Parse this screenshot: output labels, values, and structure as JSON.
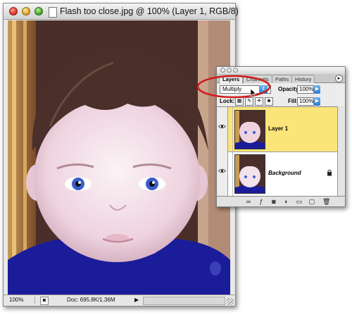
{
  "document": {
    "title": "Flash too close.jpg @ 100% (Layer 1, RGB/8)",
    "zoom": "100%",
    "doc_info": "Doc: 695.8K/1.36M"
  },
  "palette": {
    "tabs": [
      {
        "label": "Layers"
      },
      {
        "label": "Channels"
      },
      {
        "label": "Paths"
      },
      {
        "label": "History"
      }
    ],
    "blend_mode": "Multiply",
    "opacity_label": "Opacity:",
    "opacity_value": "100%",
    "lock_label": "Lock:",
    "fill_label": "Fill:",
    "fill_value": "100%",
    "layers": [
      {
        "name": "Layer 1",
        "selected": true
      },
      {
        "name": "Background",
        "selected": false
      }
    ]
  },
  "colors": {
    "selected_layer": "#fbe57a",
    "annotation": "#d11a1a",
    "accent_blue": "#2a7ad0"
  },
  "icons": [
    "close-icon",
    "minimize-icon",
    "zoom-icon",
    "document-icon",
    "eye-icon",
    "lock-icon",
    "palette-menu-icon",
    "cursor-icon",
    "new-layer-icon",
    "trash-icon"
  ]
}
